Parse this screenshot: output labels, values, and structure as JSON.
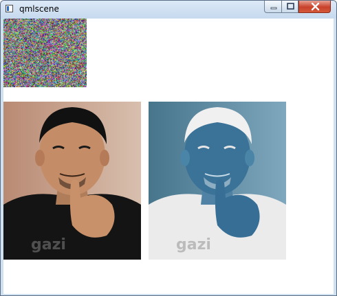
{
  "window": {
    "title": "qmlscene",
    "icons": {
      "app": "qt-window-icon",
      "minimize": "minimize-icon",
      "maximize": "maximize-icon",
      "close": "close-icon"
    }
  },
  "content": {
    "noise_image": "random-color-noise-image",
    "photos": [
      {
        "name": "original-portrait-photo",
        "watermark": "gazi"
      },
      {
        "name": "inverted-portrait-photo",
        "watermark": "gazi"
      }
    ]
  },
  "colors": {
    "titlebar": "#c6d9ee",
    "close_button": "#c8412b",
    "client_background": "#ffffff"
  }
}
